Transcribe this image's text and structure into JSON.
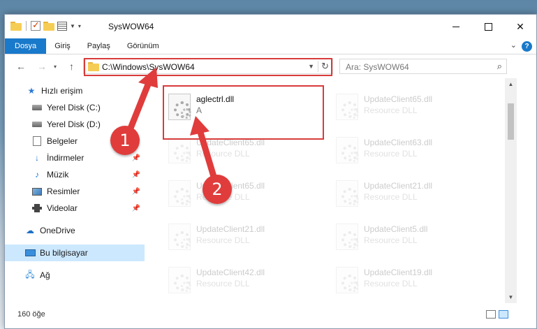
{
  "window": {
    "title": "SysWOW64"
  },
  "ribbon": {
    "tabs": [
      {
        "label": "Dosya",
        "active": true
      },
      {
        "label": "Giriş"
      },
      {
        "label": "Paylaş"
      },
      {
        "label": "Görünüm"
      }
    ],
    "help_label": "?"
  },
  "address": {
    "path": "C:\\Windows\\SysWOW64"
  },
  "search": {
    "placeholder": "Ara: SysWOW64"
  },
  "sidebar": {
    "items": [
      {
        "label": "Hızlı erişim",
        "icon": "star-icon",
        "pinned": false
      },
      {
        "label": "Yerel Disk (C:)",
        "icon": "disk-icon",
        "pinned": false
      },
      {
        "label": "Yerel Disk (D:)",
        "icon": "disk-icon",
        "pinned": false
      },
      {
        "label": "Belgeler",
        "icon": "document-icon",
        "pinned": true
      },
      {
        "label": "İndirmeler",
        "icon": "download-icon",
        "pinned": true
      },
      {
        "label": "Müzik",
        "icon": "music-icon",
        "pinned": true
      },
      {
        "label": "Resimler",
        "icon": "pictures-icon",
        "pinned": true
      },
      {
        "label": "Videolar",
        "icon": "video-icon",
        "pinned": true
      },
      {
        "label": "OneDrive",
        "icon": "cloud-icon",
        "pinned": false
      },
      {
        "label": "Bu bilgisayar",
        "icon": "pc-icon",
        "pinned": false,
        "selected": true
      },
      {
        "label": "Ağ",
        "icon": "network-icon",
        "pinned": false
      }
    ]
  },
  "files": {
    "highlighted": {
      "name": "aglectrl.dll",
      "desc": "A"
    },
    "items": [
      {
        "name": "UpdateClient65.dll",
        "desc": "Resource DLL"
      },
      {
        "name": "UpdateClient65.dll",
        "desc": "Resource DLL"
      },
      {
        "name": "UpdateClient63.dll",
        "desc": "Resource DLL"
      },
      {
        "name": "UpdateClient65.dll",
        "desc": "Resource DLL"
      },
      {
        "name": "UpdateClient21.dll",
        "desc": "Resource DLL"
      },
      {
        "name": "UpdateClient21.dll",
        "desc": "Resource DLL"
      },
      {
        "name": "UpdateClient5.dll",
        "desc": "Resource DLL"
      },
      {
        "name": "UpdateClient42.dll",
        "desc": "Resource DLL"
      },
      {
        "name": "UpdateClient19.dll",
        "desc": "Resource DLL"
      }
    ]
  },
  "status": {
    "count": "160 öğe"
  },
  "annotations": {
    "step1": "1",
    "step2": "2"
  },
  "colors": {
    "accent": "#1979ca",
    "highlight": "#d83b3b",
    "selection": "#cce8ff"
  }
}
